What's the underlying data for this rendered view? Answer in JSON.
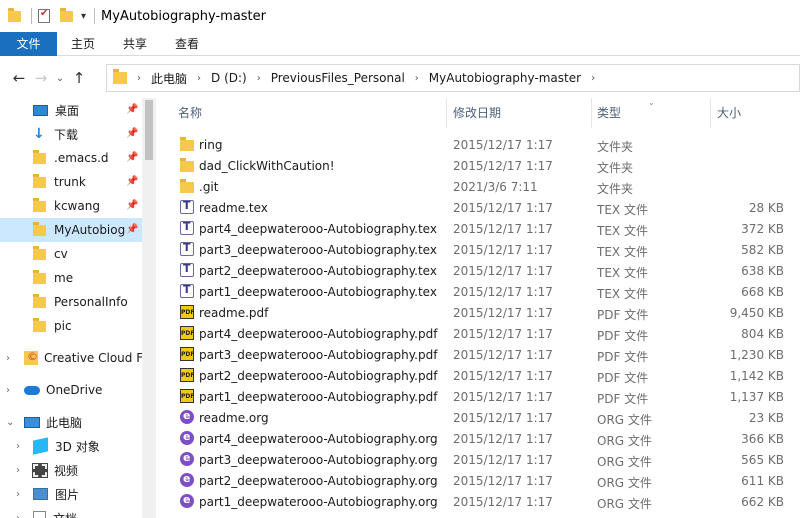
{
  "window": {
    "title": "MyAutobiography-master"
  },
  "ribbon": {
    "tabs": [
      "文件",
      "主页",
      "共享",
      "查看"
    ]
  },
  "address": {
    "crumbs": [
      "此电脑",
      "D (D:)",
      "PreviousFiles_Personal",
      "MyAutobiography-master"
    ]
  },
  "sidebar": {
    "quick_access": [
      {
        "label": "桌面",
        "icon": "desktop-icon",
        "pinned": true
      },
      {
        "label": "下载",
        "icon": "download-icon",
        "pinned": true
      },
      {
        "label": ".emacs.d",
        "icon": "folder-icon",
        "pinned": true
      },
      {
        "label": "trunk",
        "icon": "folder-icon",
        "pinned": true
      },
      {
        "label": "kcwang",
        "icon": "folder-icon",
        "pinned": true
      },
      {
        "label": "MyAutobiog",
        "icon": "folder-icon",
        "pinned": true,
        "selected": true
      },
      {
        "label": "cv",
        "icon": "folder-icon"
      },
      {
        "label": "me",
        "icon": "folder-icon"
      },
      {
        "label": "PersonalInfo",
        "icon": "folder-icon"
      },
      {
        "label": "pic",
        "icon": "folder-icon"
      }
    ],
    "creative_cloud": "Creative Cloud F",
    "onedrive": "OneDrive",
    "this_pc": "此电脑",
    "pc_items": [
      "3D 对象",
      "视频",
      "图片",
      "文档"
    ]
  },
  "columns": {
    "name": "名称",
    "date": "修改日期",
    "type": "类型",
    "size": "大小"
  },
  "files": [
    {
      "name": "ring",
      "date": "2015/12/17 1:17",
      "type": "文件夹",
      "size": "",
      "kind": "folder"
    },
    {
      "name": "dad_ClickWithCaution!",
      "date": "2015/12/17 1:17",
      "type": "文件夹",
      "size": "",
      "kind": "folder"
    },
    {
      "name": ".git",
      "date": "2021/3/6 7:11",
      "type": "文件夹",
      "size": "",
      "kind": "folder"
    },
    {
      "name": "readme.tex",
      "date": "2015/12/17 1:17",
      "type": "TEX 文件",
      "size": "28 KB",
      "kind": "tex"
    },
    {
      "name": "part4_deepwaterooo-Autobiography.tex",
      "date": "2015/12/17 1:17",
      "type": "TEX 文件",
      "size": "372 KB",
      "kind": "tex"
    },
    {
      "name": "part3_deepwaterooo-Autobiography.tex",
      "date": "2015/12/17 1:17",
      "type": "TEX 文件",
      "size": "582 KB",
      "kind": "tex"
    },
    {
      "name": "part2_deepwaterooo-Autobiography.tex",
      "date": "2015/12/17 1:17",
      "type": "TEX 文件",
      "size": "638 KB",
      "kind": "tex"
    },
    {
      "name": "part1_deepwaterooo-Autobiography.tex",
      "date": "2015/12/17 1:17",
      "type": "TEX 文件",
      "size": "668 KB",
      "kind": "tex"
    },
    {
      "name": "readme.pdf",
      "date": "2015/12/17 1:17",
      "type": "PDF 文件",
      "size": "9,450 KB",
      "kind": "pdf"
    },
    {
      "name": "part4_deepwaterooo-Autobiography.pdf",
      "date": "2015/12/17 1:17",
      "type": "PDF 文件",
      "size": "804 KB",
      "kind": "pdf"
    },
    {
      "name": "part3_deepwaterooo-Autobiography.pdf",
      "date": "2015/12/17 1:17",
      "type": "PDF 文件",
      "size": "1,230 KB",
      "kind": "pdf"
    },
    {
      "name": "part2_deepwaterooo-Autobiography.pdf",
      "date": "2015/12/17 1:17",
      "type": "PDF 文件",
      "size": "1,142 KB",
      "kind": "pdf"
    },
    {
      "name": "part1_deepwaterooo-Autobiography.pdf",
      "date": "2015/12/17 1:17",
      "type": "PDF 文件",
      "size": "1,137 KB",
      "kind": "pdf"
    },
    {
      "name": "readme.org",
      "date": "2015/12/17 1:17",
      "type": "ORG 文件",
      "size": "23 KB",
      "kind": "org"
    },
    {
      "name": "part4_deepwaterooo-Autobiography.org",
      "date": "2015/12/17 1:17",
      "type": "ORG 文件",
      "size": "366 KB",
      "kind": "org"
    },
    {
      "name": "part3_deepwaterooo-Autobiography.org",
      "date": "2015/12/17 1:17",
      "type": "ORG 文件",
      "size": "565 KB",
      "kind": "org"
    },
    {
      "name": "part2_deepwaterooo-Autobiography.org",
      "date": "2015/12/17 1:17",
      "type": "ORG 文件",
      "size": "611 KB",
      "kind": "org"
    },
    {
      "name": "part1_deepwaterooo-Autobiography.org",
      "date": "2015/12/17 1:17",
      "type": "ORG 文件",
      "size": "662 KB",
      "kind": "org"
    }
  ]
}
